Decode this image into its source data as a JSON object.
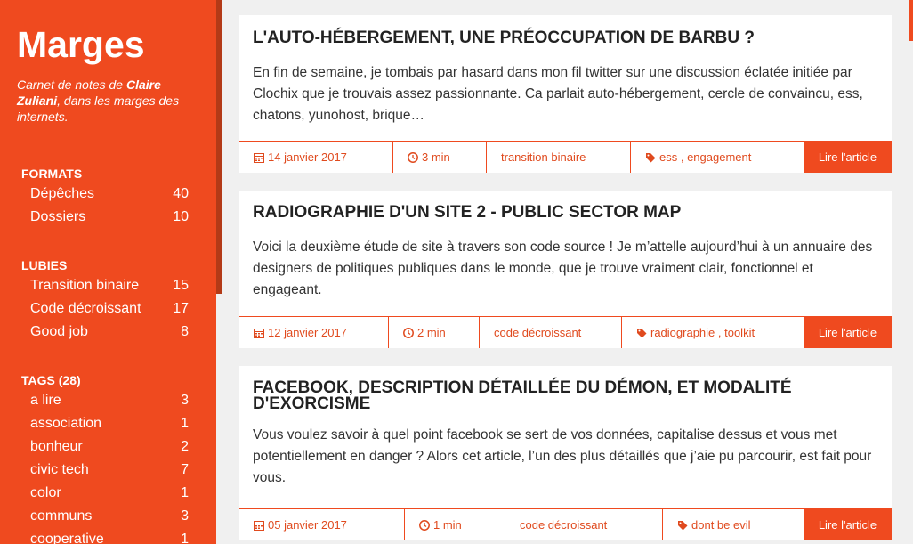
{
  "sidebar": {
    "logo": "Marges",
    "tagline_pre": "Carnet de notes de ",
    "tagline_author": "Claire Zuliani",
    "tagline_post": ", dans les marges des internets.",
    "formats_title": "FORMATS",
    "formats": [
      {
        "label": "Dépêches",
        "count": "40"
      },
      {
        "label": "Dossiers",
        "count": "10"
      }
    ],
    "lubies_title": "LUBIES",
    "lubies": [
      {
        "label": "Transition binaire",
        "count": "15"
      },
      {
        "label": "Code décroissant",
        "count": "17"
      },
      {
        "label": "Good job",
        "count": "8"
      }
    ],
    "tags_title": "TAGS (28)",
    "tags": [
      {
        "label": "a lire",
        "count": "3"
      },
      {
        "label": "association",
        "count": "1"
      },
      {
        "label": "bonheur",
        "count": "2"
      },
      {
        "label": "civic tech",
        "count": "7"
      },
      {
        "label": "color",
        "count": "1"
      },
      {
        "label": "communs",
        "count": "3"
      },
      {
        "label": "cooperative",
        "count": "1"
      }
    ]
  },
  "articles": [
    {
      "title": "L'AUTO-HÉBERGEMENT, UNE PRÉOCCUPATION DE BARBU ?",
      "excerpt": "En fin de semaine, je tombais par hasard dans mon fil twitter sur une discussion éclatée initiée par Clochix que je trouvais assez passionnante. Ca parlait auto-hébergement, cercle de convaincu, ess, chatons, yunohost, brique…",
      "date": "14 janvier 2017",
      "duration": "3 min",
      "lubie": "transition binaire",
      "tags": "ess , engagement",
      "read": "Lire l'article"
    },
    {
      "title": "RADIOGRAPHIE D'UN SITE 2 - PUBLIC SECTOR MAP",
      "excerpt": "Voici la deuxième étude de site à travers son code source ! Je m’attelle aujourd’hui à un annuaire des designers de politiques publiques dans le monde, que je trouve vraiment clair, fonctionnel et engageant.",
      "date": "12 janvier 2017",
      "duration": "2 min",
      "lubie": "code décroissant",
      "tags": "radiographie , toolkit",
      "read": "Lire l'article"
    },
    {
      "title": "FACEBOOK, DESCRIPTION DÉTAILLÉE DU DÉMON, ET MODALITÉ D'EXORCISME",
      "excerpt": "Vous voulez savoir à quel point facebook se sert de vos données, capitalise dessus et vous met potentiellement en danger ? Alors cet article, l’un des plus détaillés que j’aie pu parcourir, est fait pour vous.",
      "date": "05 janvier 2017",
      "duration": "1 min",
      "lubie": "code décroissant",
      "tags": "dont be evil",
      "read": "Lire l'article"
    }
  ],
  "colors": {
    "accent": "#ef4a1f",
    "background": "#f0f0f0"
  }
}
